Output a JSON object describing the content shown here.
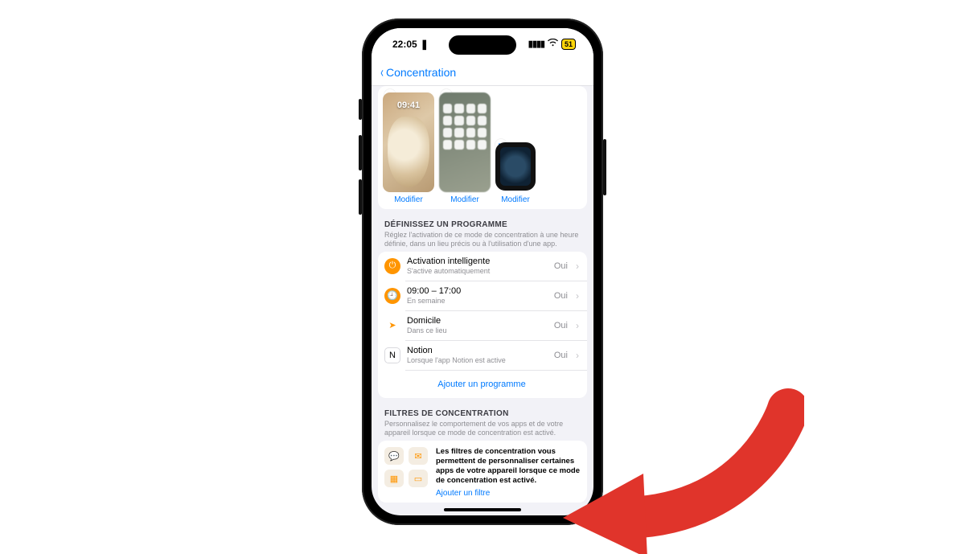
{
  "status": {
    "time": "22:05",
    "battery": "51"
  },
  "nav": {
    "back_label": "Concentration"
  },
  "screens": {
    "time": "09:41",
    "modify_label": "Modifier"
  },
  "schedule": {
    "header": "DÉFINISSEZ UN PROGRAMME",
    "desc": "Réglez l'activation de ce mode de concentration à une heure définie, dans un lieu précis ou à l'utilisation d'une app.",
    "items": [
      {
        "title": "Activation intelligente",
        "sub": "S'active automatiquement",
        "value": "Oui",
        "icon": "power"
      },
      {
        "title": "09:00 – 17:00",
        "sub": "En semaine",
        "value": "Oui",
        "icon": "clock"
      },
      {
        "title": "Domicile",
        "sub": "Dans ce lieu",
        "value": "Oui",
        "icon": "location"
      },
      {
        "title": "Notion",
        "sub": "Lorsque l'app Notion est active",
        "value": "Oui",
        "icon": "notion"
      }
    ],
    "add_label": "Ajouter un programme"
  },
  "filters": {
    "header": "FILTRES DE CONCENTRATION",
    "desc": "Personnalisez le comportement de vos apps et de votre appareil lorsque ce mode de concentration est activé.",
    "body": "Les filtres de concentration vous permettent de personnaliser certaines apps de votre appareil lorsque ce mode de concentration est activé.",
    "add_label": "Ajouter un filtre"
  }
}
